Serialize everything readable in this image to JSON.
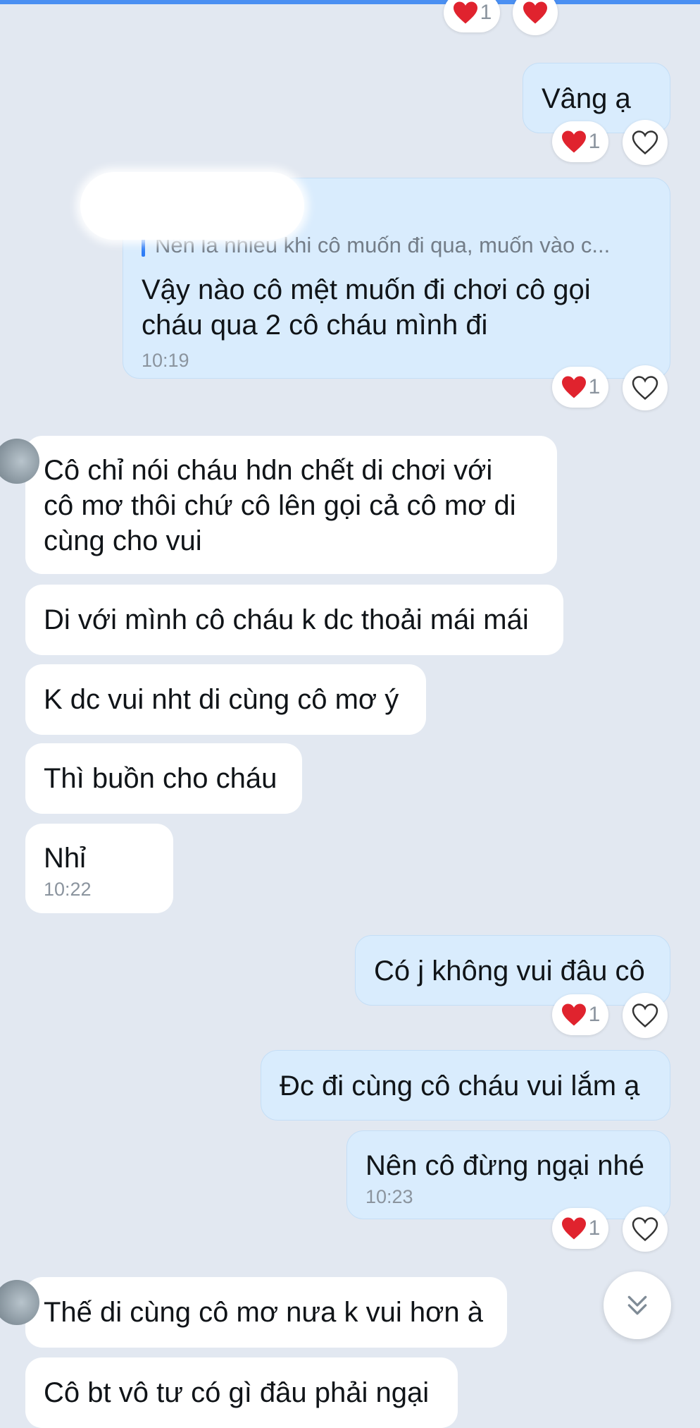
{
  "colors": {
    "heart": "#e0232e",
    "accent": "#2d7cf6",
    "outgoing_bubble": "#d9ecfd",
    "incoming_bubble": "#ffffff"
  },
  "icons": {
    "reaction": "heart-icon",
    "like_button": "heart-outline-icon",
    "scroll": "double-chevron-down-icon"
  },
  "top_reactions": {
    "count": "1"
  },
  "messages": [
    {
      "text": "Vâng ạ",
      "reaction_count": "1"
    },
    {
      "quote": "Nên là nhiều khi cô muốn đi qua, muốn vào c...",
      "text": "Vậy nào cô mệt muốn đi chơi cô gọi\ncháu qua 2 cô cháu mình đi",
      "time": "10:19",
      "reaction_count": "1"
    },
    {
      "text": "Cô chỉ nói cháu hdn chết di chơi với\ncô mơ thôi chứ cô lên gọi cả cô mơ di\ncùng cho vui"
    },
    {
      "text": "Di với mình cô cháu k dc thoải mái mái"
    },
    {
      "text": "K dc vui nht di cùng cô mơ ý"
    },
    {
      "text": "Thì buồn cho cháu"
    },
    {
      "text": "Nhỉ",
      "time": "10:22"
    },
    {
      "text": "Có j không vui đâu cô",
      "reaction_count": "1"
    },
    {
      "text": "Đc đi cùng cô cháu vui lắm ạ"
    },
    {
      "text": "Nên cô đừng ngại nhé",
      "time": "10:23",
      "reaction_count": "1"
    },
    {
      "text": "Thế di cùng cô mơ nưa k vui hơn à"
    },
    {
      "text": "Cô bt vô tư có gì đâu phải ngại"
    }
  ]
}
